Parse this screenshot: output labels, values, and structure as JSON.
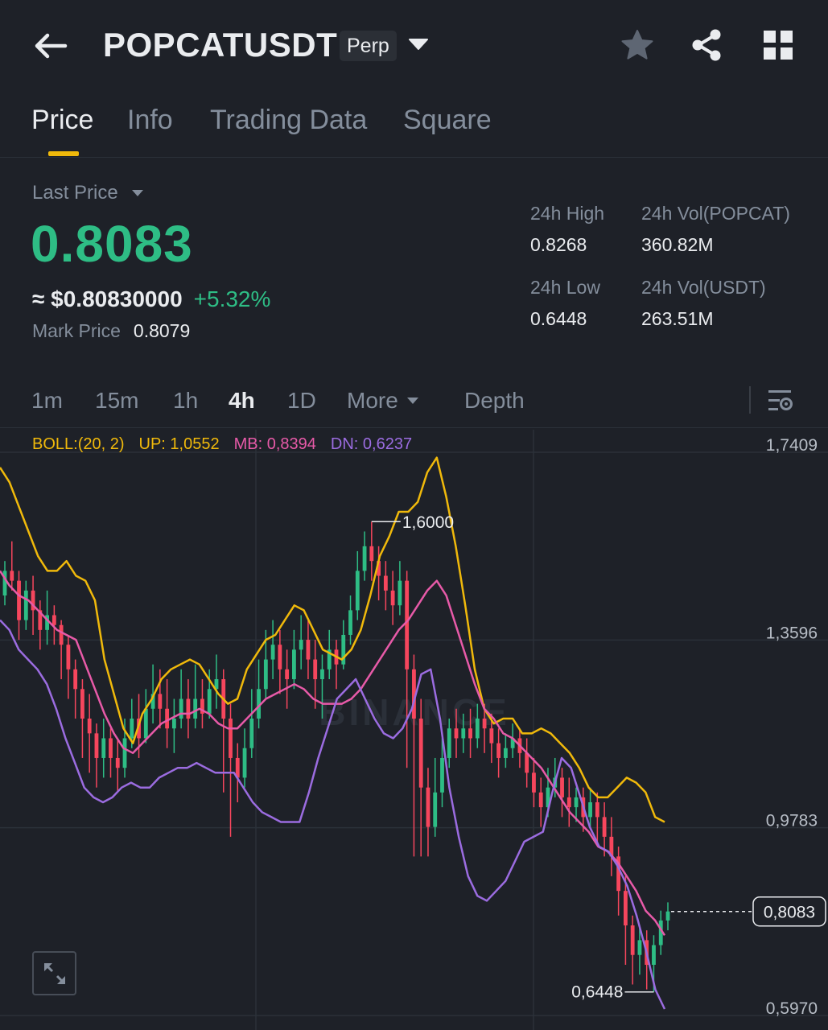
{
  "header": {
    "symbol": "POPCATUSDT",
    "badge": "Perp"
  },
  "tabs": [
    {
      "label": "Price",
      "active": true
    },
    {
      "label": "Info",
      "active": false
    },
    {
      "label": "Trading Data",
      "active": false
    },
    {
      "label": "Square",
      "active": false
    }
  ],
  "ticker": {
    "last_price_label": "Last Price",
    "last_price": "0.8083",
    "usd_price": "≈ $0.80830000",
    "change_pct": "+5.32%",
    "mark_price_label": "Mark Price",
    "mark_price": "0.8079"
  },
  "stats": {
    "high_label": "24h High",
    "high_value": "0.8268",
    "low_label": "24h Low",
    "low_value": "0.6448",
    "vol_base_label": "24h Vol(POPCAT)",
    "vol_base_value": "360.82M",
    "vol_quote_label": "24h Vol(USDT)",
    "vol_quote_value": "263.51M"
  },
  "intervals": {
    "items": [
      {
        "label": "1m",
        "active": false
      },
      {
        "label": "15m",
        "active": false
      },
      {
        "label": "1h",
        "active": false
      },
      {
        "label": "4h",
        "active": true
      },
      {
        "label": "1D",
        "active": false
      }
    ],
    "more_label": "More",
    "depth_label": "Depth"
  },
  "indicator": {
    "name": "BOLL:(20, 2)",
    "up": "UP: 1,0552",
    "mb": "MB: 0,8394",
    "dn": "DN: 0,6237"
  },
  "colors": {
    "up": "#2ebd85",
    "down": "#f6465d",
    "boll_up": "#f0b90b",
    "boll_mb": "#e75aa8",
    "boll_dn": "#9b6ce0",
    "accent": "#f0b90b"
  },
  "chart_data": {
    "type": "candlestick",
    "title": "",
    "y_ticks": [
      "1,7409",
      "1,3596",
      "0,9783",
      "0,5970"
    ],
    "ylim": [
      0.597,
      1.7409
    ],
    "current_price_label": "0,8083",
    "high_marker_label": "1,6000",
    "low_marker_label": "0,6448",
    "watermark": "BINANCE",
    "series": [
      {
        "name": "UP",
        "values": [
          1.71,
          1.68,
          1.63,
          1.58,
          1.53,
          1.5,
          1.5,
          1.52,
          1.49,
          1.48,
          1.44,
          1.32,
          1.25,
          1.18,
          1.15,
          1.21,
          1.24,
          1.28,
          1.3,
          1.31,
          1.32,
          1.31,
          1.28,
          1.25,
          1.23,
          1.24,
          1.3,
          1.33,
          1.36,
          1.37,
          1.4,
          1.43,
          1.42,
          1.38,
          1.34,
          1.33,
          1.32,
          1.34,
          1.38,
          1.45,
          1.53,
          1.57,
          1.62,
          1.62,
          1.64,
          1.7,
          1.73,
          1.65,
          1.55,
          1.43,
          1.3,
          1.22,
          1.19,
          1.2,
          1.2,
          1.17,
          1.17,
          1.18,
          1.17,
          1.15,
          1.13,
          1.1,
          1.06,
          1.04,
          1.04,
          1.06,
          1.08,
          1.07,
          1.05,
          1.0,
          0.99
        ]
      },
      {
        "name": "MB",
        "values": [
          1.5,
          1.47,
          1.45,
          1.44,
          1.42,
          1.4,
          1.38,
          1.37,
          1.36,
          1.31,
          1.26,
          1.21,
          1.17,
          1.14,
          1.13,
          1.15,
          1.17,
          1.19,
          1.2,
          1.21,
          1.21,
          1.22,
          1.21,
          1.19,
          1.18,
          1.18,
          1.2,
          1.22,
          1.24,
          1.25,
          1.26,
          1.27,
          1.26,
          1.24,
          1.23,
          1.23,
          1.23,
          1.24,
          1.26,
          1.29,
          1.32,
          1.35,
          1.38,
          1.4,
          1.43,
          1.46,
          1.48,
          1.45,
          1.39,
          1.33,
          1.27,
          1.22,
          1.2,
          1.17,
          1.16,
          1.14,
          1.12,
          1.1,
          1.07,
          1.04,
          1.01,
          0.99,
          0.97,
          0.94,
          0.93,
          0.91,
          0.88,
          0.85,
          0.81,
          0.79,
          0.76
        ]
      },
      {
        "name": "DN",
        "values": [
          1.4,
          1.38,
          1.34,
          1.32,
          1.3,
          1.27,
          1.22,
          1.16,
          1.11,
          1.06,
          1.04,
          1.03,
          1.04,
          1.06,
          1.07,
          1.06,
          1.06,
          1.08,
          1.09,
          1.1,
          1.1,
          1.11,
          1.1,
          1.09,
          1.09,
          1.09,
          1.06,
          1.03,
          1.01,
          1.0,
          0.99,
          0.99,
          0.99,
          1.05,
          1.12,
          1.18,
          1.24,
          1.26,
          1.28,
          1.24,
          1.2,
          1.17,
          1.16,
          1.18,
          1.22,
          1.29,
          1.3,
          1.2,
          1.06,
          0.96,
          0.88,
          0.84,
          0.83,
          0.85,
          0.87,
          0.91,
          0.95,
          0.96,
          0.97,
          1.05,
          1.12,
          1.1,
          1.04,
          0.98,
          0.94,
          0.93,
          0.9,
          0.86,
          0.8,
          0.73,
          0.65,
          0.61
        ]
      }
    ],
    "candles": [
      [
        1.45,
        1.5,
        1.43,
        1.52
      ],
      [
        1.5,
        1.48,
        1.46,
        1.56
      ],
      [
        1.48,
        1.4,
        1.36,
        1.5
      ],
      [
        1.4,
        1.46,
        1.38,
        1.48
      ],
      [
        1.46,
        1.42,
        1.37,
        1.49
      ],
      [
        1.42,
        1.38,
        1.34,
        1.44
      ],
      [
        1.38,
        1.41,
        1.35,
        1.46
      ],
      [
        1.41,
        1.39,
        1.35,
        1.43
      ],
      [
        1.39,
        1.35,
        1.28,
        1.4
      ],
      [
        1.35,
        1.3,
        1.24,
        1.37
      ],
      [
        1.3,
        1.26,
        1.2,
        1.32
      ],
      [
        1.26,
        1.2,
        1.12,
        1.28
      ],
      [
        1.2,
        1.17,
        1.09,
        1.25
      ],
      [
        1.17,
        1.12,
        1.06,
        1.19
      ],
      [
        1.12,
        1.16,
        1.08,
        1.2
      ],
      [
        1.16,
        1.12,
        1.08,
        1.18
      ],
      [
        1.12,
        1.1,
        1.05,
        1.16
      ],
      [
        1.1,
        1.16,
        1.08,
        1.2
      ],
      [
        1.16,
        1.2,
        1.14,
        1.24
      ],
      [
        1.2,
        1.16,
        1.12,
        1.25
      ],
      [
        1.16,
        1.22,
        1.15,
        1.26
      ],
      [
        1.22,
        1.25,
        1.19,
        1.31
      ],
      [
        1.25,
        1.22,
        1.18,
        1.3
      ],
      [
        1.22,
        1.18,
        1.14,
        1.28
      ],
      [
        1.18,
        1.2,
        1.13,
        1.24
      ],
      [
        1.2,
        1.24,
        1.18,
        1.3
      ],
      [
        1.24,
        1.2,
        1.16,
        1.28
      ],
      [
        1.2,
        1.24,
        1.18,
        1.31
      ],
      [
        1.24,
        1.21,
        1.18,
        1.28
      ],
      [
        1.21,
        1.26,
        1.2,
        1.3
      ],
      [
        1.26,
        1.28,
        1.22,
        1.33
      ],
      [
        1.28,
        1.2,
        1.05,
        1.3
      ],
      [
        1.2,
        1.12,
        0.96,
        1.23
      ],
      [
        1.12,
        1.08,
        1.03,
        1.15
      ],
      [
        1.08,
        1.14,
        1.06,
        1.18
      ],
      [
        1.14,
        1.2,
        1.12,
        1.26
      ],
      [
        1.2,
        1.26,
        1.18,
        1.32
      ],
      [
        1.26,
        1.32,
        1.24,
        1.38
      ],
      [
        1.32,
        1.35,
        1.28,
        1.4
      ],
      [
        1.35,
        1.3,
        1.25,
        1.38
      ],
      [
        1.3,
        1.28,
        1.22,
        1.34
      ],
      [
        1.28,
        1.34,
        1.26,
        1.38
      ],
      [
        1.34,
        1.36,
        1.3,
        1.41
      ],
      [
        1.36,
        1.32,
        1.28,
        1.4
      ],
      [
        1.32,
        1.28,
        1.22,
        1.36
      ],
      [
        1.28,
        1.3,
        1.2,
        1.33
      ],
      [
        1.3,
        1.34,
        1.28,
        1.38
      ],
      [
        1.34,
        1.31,
        1.26,
        1.36
      ],
      [
        1.31,
        1.37,
        1.3,
        1.4
      ],
      [
        1.37,
        1.42,
        1.35,
        1.45
      ],
      [
        1.42,
        1.5,
        1.4,
        1.54
      ],
      [
        1.5,
        1.55,
        1.48,
        1.58
      ],
      [
        1.55,
        1.52,
        1.48,
        1.6
      ],
      [
        1.52,
        1.49,
        1.44,
        1.55
      ],
      [
        1.49,
        1.46,
        1.42,
        1.52
      ],
      [
        1.46,
        1.43,
        1.39,
        1.5
      ],
      [
        1.43,
        1.48,
        1.41,
        1.52
      ],
      [
        1.48,
        1.3,
        1.1,
        1.5
      ],
      [
        1.3,
        1.2,
        0.92,
        1.33
      ],
      [
        1.2,
        1.06,
        0.92,
        1.24
      ],
      [
        1.06,
        0.98,
        0.92,
        1.1
      ],
      [
        0.98,
        1.05,
        0.96,
        1.12
      ],
      [
        1.05,
        1.12,
        1.02,
        1.16
      ],
      [
        1.12,
        1.18,
        1.1,
        1.2
      ],
      [
        1.18,
        1.16,
        1.12,
        1.22
      ],
      [
        1.16,
        1.18,
        1.13,
        1.21
      ],
      [
        1.18,
        1.16,
        1.12,
        1.22
      ],
      [
        1.16,
        1.2,
        1.14,
        1.23
      ],
      [
        1.2,
        1.18,
        1.13,
        1.23
      ],
      [
        1.18,
        1.15,
        1.11,
        1.21
      ],
      [
        1.15,
        1.12,
        1.08,
        1.18
      ],
      [
        1.12,
        1.14,
        1.1,
        1.17
      ],
      [
        1.14,
        1.16,
        1.12,
        1.19
      ],
      [
        1.16,
        1.13,
        1.1,
        1.18
      ],
      [
        1.13,
        1.09,
        1.06,
        1.16
      ],
      [
        1.09,
        1.05,
        1.02,
        1.12
      ],
      [
        1.05,
        1.02,
        0.98,
        1.08
      ],
      [
        1.02,
        1.06,
        1.0,
        1.1
      ],
      [
        1.06,
        1.08,
        1.04,
        1.12
      ],
      [
        1.08,
        1.04,
        1.0,
        1.1
      ],
      [
        1.04,
        1.02,
        0.98,
        1.08
      ],
      [
        1.02,
        1.04,
        0.99,
        1.06
      ],
      [
        1.04,
        1.0,
        0.97,
        1.06
      ],
      [
        1.0,
        1.03,
        0.98,
        1.06
      ],
      [
        1.03,
        1.0,
        0.95,
        1.05
      ],
      [
        1.0,
        0.96,
        0.92,
        1.03
      ],
      [
        0.96,
        0.92,
        0.88,
        1.0
      ],
      [
        0.92,
        0.85,
        0.8,
        0.94
      ],
      [
        0.85,
        0.78,
        0.7,
        0.88
      ],
      [
        0.78,
        0.72,
        0.66,
        0.8
      ],
      [
        0.72,
        0.75,
        0.68,
        0.78
      ],
      [
        0.75,
        0.7,
        0.65,
        0.77
      ],
      [
        0.7,
        0.74,
        0.6448,
        0.76
      ],
      [
        0.74,
        0.79,
        0.72,
        0.81
      ],
      [
        0.79,
        0.8083,
        0.77,
        0.8268
      ]
    ]
  }
}
